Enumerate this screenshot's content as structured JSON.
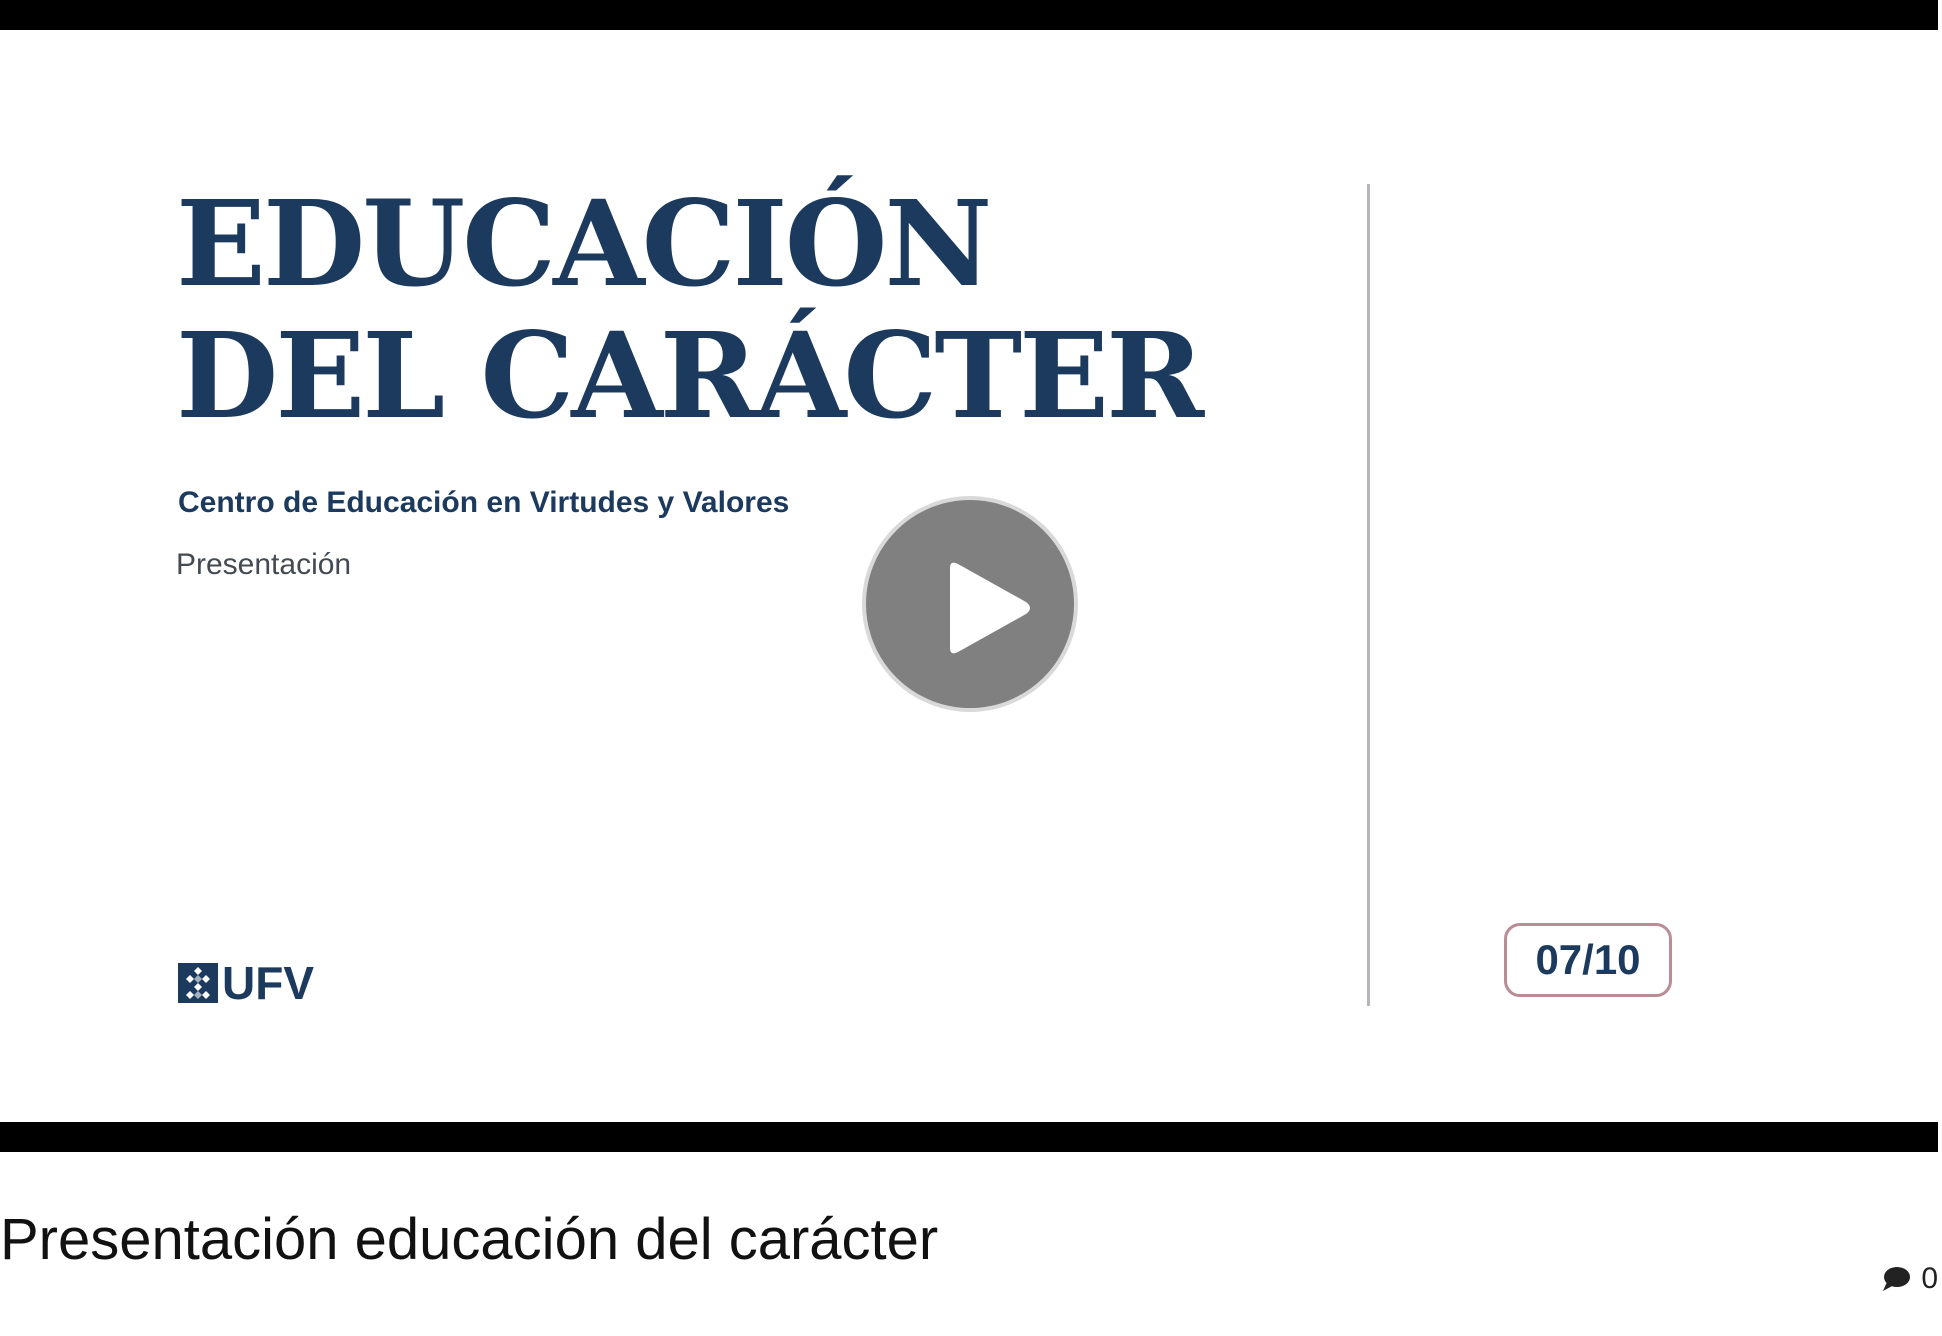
{
  "slide": {
    "title_line1": "EDUCACIÓN",
    "title_line2": "DEL CARÁCTER",
    "subtitle": "Centro de Educación en Virtudes y Valores",
    "caption": "Presentación",
    "logo_text": "UFV",
    "counter": "07/10"
  },
  "player": {
    "play_icon": "play-icon"
  },
  "video": {
    "title": "Presentación educación del carácter",
    "comment_icon": "comment-icon",
    "comment_count": "0"
  },
  "colors": {
    "brand_navy": "#1c3a5e",
    "counter_border": "#b98c96",
    "letterbox": "#000000"
  }
}
